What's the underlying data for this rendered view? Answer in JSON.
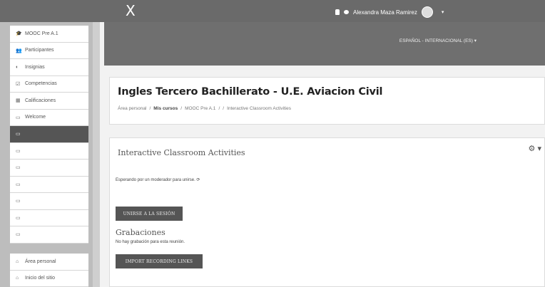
{
  "topbar": {
    "close_glyph": "X",
    "user_name": "Alexandra Maza Ramirez",
    "icons": [
      "bell-icon",
      "chat-icon",
      "avatar",
      "caret-down-icon"
    ]
  },
  "sidebar": {
    "items": [
      {
        "icon": "graduation-cap-icon",
        "glyph": "🎓",
        "label": "MOOC Pre A.1"
      },
      {
        "icon": "users-icon",
        "glyph": "👥",
        "label": "Participantes"
      },
      {
        "icon": "badge-icon",
        "glyph": "◐",
        "label": "Insignias"
      },
      {
        "icon": "checkbox-icon",
        "glyph": "☑",
        "label": "Competencias"
      },
      {
        "icon": "grid-icon",
        "glyph": "▦",
        "label": "Calificaciones"
      },
      {
        "icon": "folder-icon",
        "glyph": "▭",
        "label": "Welcome"
      },
      {
        "icon": "folder-icon",
        "glyph": "▭",
        "label": ""
      },
      {
        "icon": "folder-icon",
        "glyph": "▭",
        "label": ""
      },
      {
        "icon": "folder-icon",
        "glyph": "▭",
        "label": ""
      },
      {
        "icon": "folder-icon",
        "glyph": "▭",
        "label": ""
      },
      {
        "icon": "folder-icon",
        "glyph": "▭",
        "label": ""
      },
      {
        "icon": "folder-icon",
        "glyph": "▭",
        "label": ""
      },
      {
        "icon": "folder-icon",
        "glyph": "▭",
        "label": ""
      }
    ],
    "active_index": 6,
    "bottom_items": [
      {
        "icon": "dashboard-icon",
        "glyph": "⌂",
        "label": "Área personal"
      },
      {
        "icon": "home-icon",
        "glyph": "⌂",
        "label": "Inicio del sitio"
      }
    ]
  },
  "banner": {
    "language": "ESPAÑOL - INTERNACIONAL (ES) ▾"
  },
  "course": {
    "title": "Ingles Tercero Bachillerato - U.E. Aviacion Civil",
    "breadcrumb": [
      "Área personal",
      "/",
      "Mis cursos",
      "/",
      "MOOC Pre A.1",
      "/",
      "/",
      "Interactive Classroom Activities"
    ]
  },
  "activity": {
    "title": "Interactive Classroom Activities",
    "waiting_text": "Esperando por un moderador para unirse.",
    "join_button": "UNIRSE A LA SESIÓN",
    "recordings_heading": "Grabaciones",
    "no_recordings": "No hay grabación para esta reunión.",
    "import_button": "IMPORT RECORDING LINKS"
  }
}
